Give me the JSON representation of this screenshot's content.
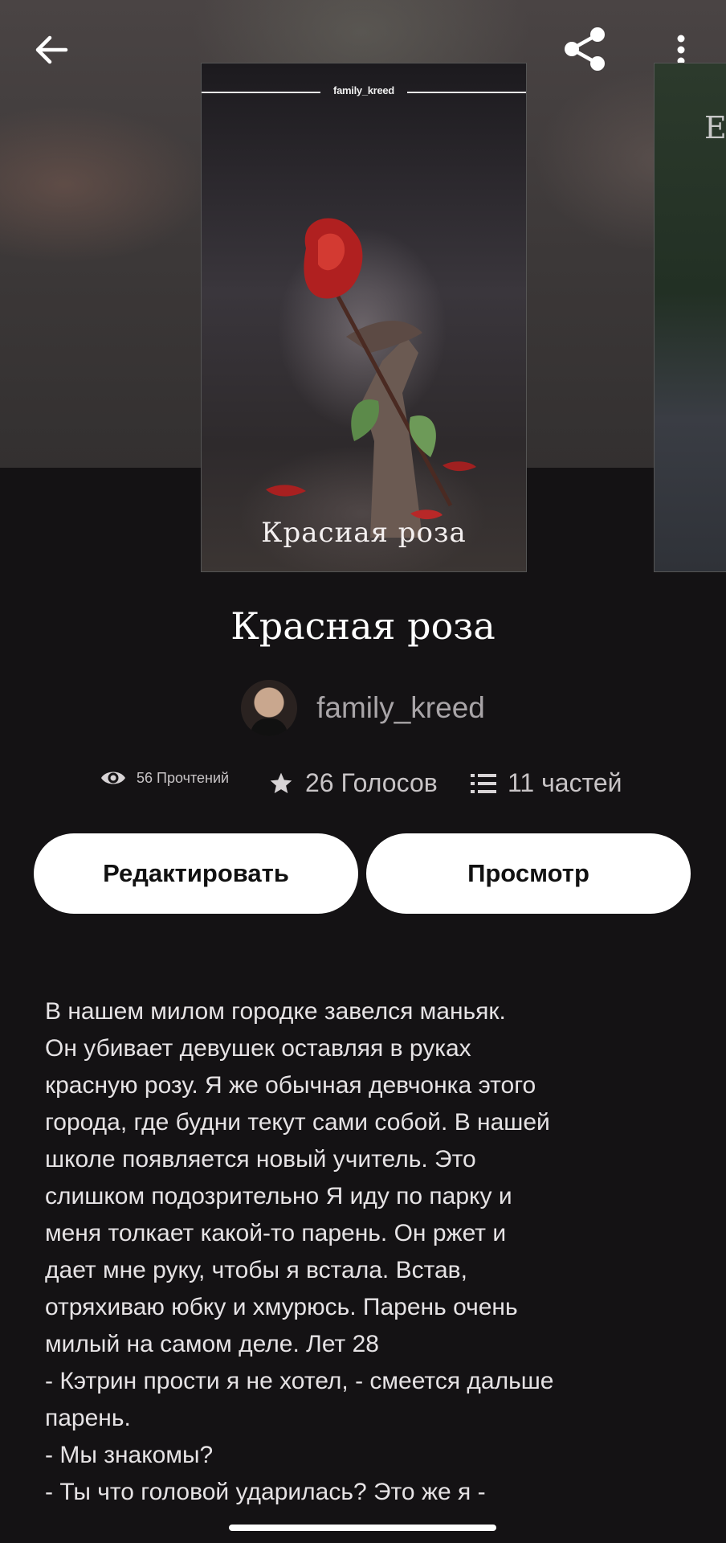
{
  "header": {
    "back_icon": "arrow-left-icon",
    "share_icon": "share-icon",
    "more_icon": "more-vertical-icon"
  },
  "cover": {
    "author_tag": "family_kreed",
    "title": "Красиая роза"
  },
  "side_cover": {
    "letter": "E"
  },
  "story": {
    "title": "Красная роза",
    "author": "family_kreed"
  },
  "stats": {
    "reads": "56 Прочтений",
    "votes": "26 Голосов",
    "parts": "11 частей"
  },
  "buttons": {
    "edit": "Редактировать",
    "view": "Просмотр"
  },
  "description": "В нашем милом городке завелся маньяк.\nОн убивает девушек оставляя в руках\nкрасную розу. Я же обычная девчонка этого\nгорода, где будни текут сами собой. В нашей\nшколе появляется новый учитель. Это\nслишком подозрительно Я иду по парку и\nменя толкает какой-то парень. Он ржет и\nдает мне руку, чтобы я встала. Встав,\nотряхиваю юбку и хмурюсь. Парень очень\nмилый на самом деле. Лет 28\n- Кэтрин прости я не хотел, - смеется дальше\nпарень.\n- Мы знакомы?\n- Ты что головой ударилась? Это же я -"
}
